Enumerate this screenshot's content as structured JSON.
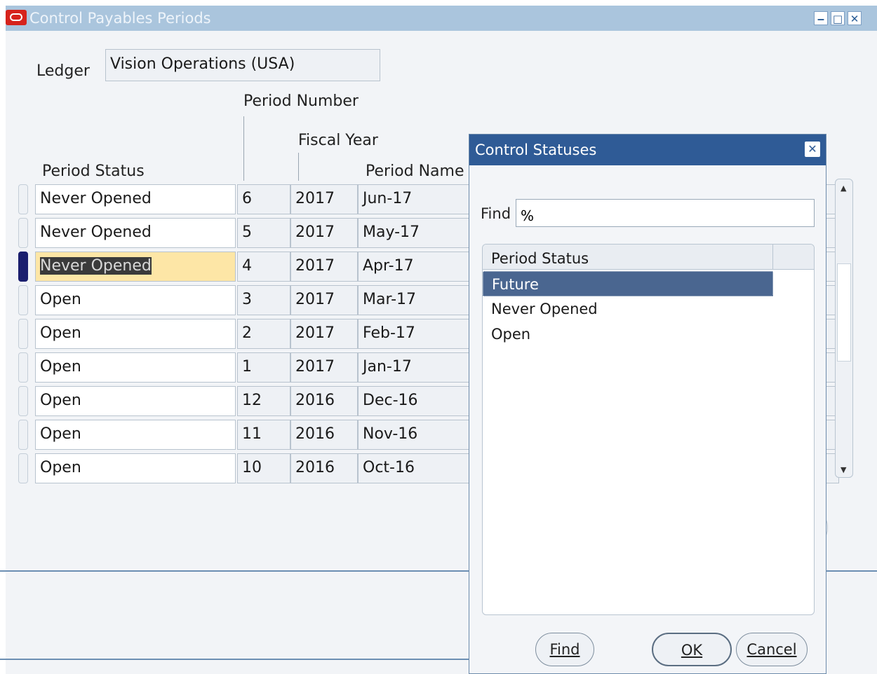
{
  "window": {
    "title": "Control Payables Periods"
  },
  "ledger": {
    "label": "Ledger",
    "value": "Vision Operations (USA)"
  },
  "columns": {
    "period_number": "Period Number",
    "fiscal_year": "Fiscal Year",
    "period_status": "Period Status",
    "period_name": "Period Name"
  },
  "rows": [
    {
      "status": "Never Opened",
      "number": "6",
      "year": "2017",
      "name": "Jun-17"
    },
    {
      "status": "Never Opened",
      "number": "5",
      "year": "2017",
      "name": "May-17"
    },
    {
      "status": "Never Opened",
      "number": "4",
      "year": "2017",
      "name": "Apr-17"
    },
    {
      "status": "Open",
      "number": "3",
      "year": "2017",
      "name": "Mar-17"
    },
    {
      "status": "Open",
      "number": "2",
      "year": "2017",
      "name": "Feb-17"
    },
    {
      "status": "Open",
      "number": "1",
      "year": "2017",
      "name": "Jan-17"
    },
    {
      "status": "Open",
      "number": "12",
      "year": "2016",
      "name": "Dec-16"
    },
    {
      "status": "Open",
      "number": "11",
      "year": "2016",
      "name": "Nov-16"
    },
    {
      "status": "Open",
      "number": "10",
      "year": "2016",
      "name": "Oct-16"
    }
  ],
  "dialog": {
    "title": "Control Statuses",
    "find_label": "Find",
    "find_value": "%",
    "list_header": "Period Status",
    "options": [
      "Future",
      "Never Opened",
      "Open"
    ],
    "selected": "Future",
    "find_button": "Find",
    "ok_button": "OK",
    "cancel_button": "Cancel"
  },
  "colors": {
    "title_bar": "#aac5dd",
    "dialog_title": "#2f5b96",
    "selection": "#4a6690",
    "current_field": "#fde6a6"
  }
}
